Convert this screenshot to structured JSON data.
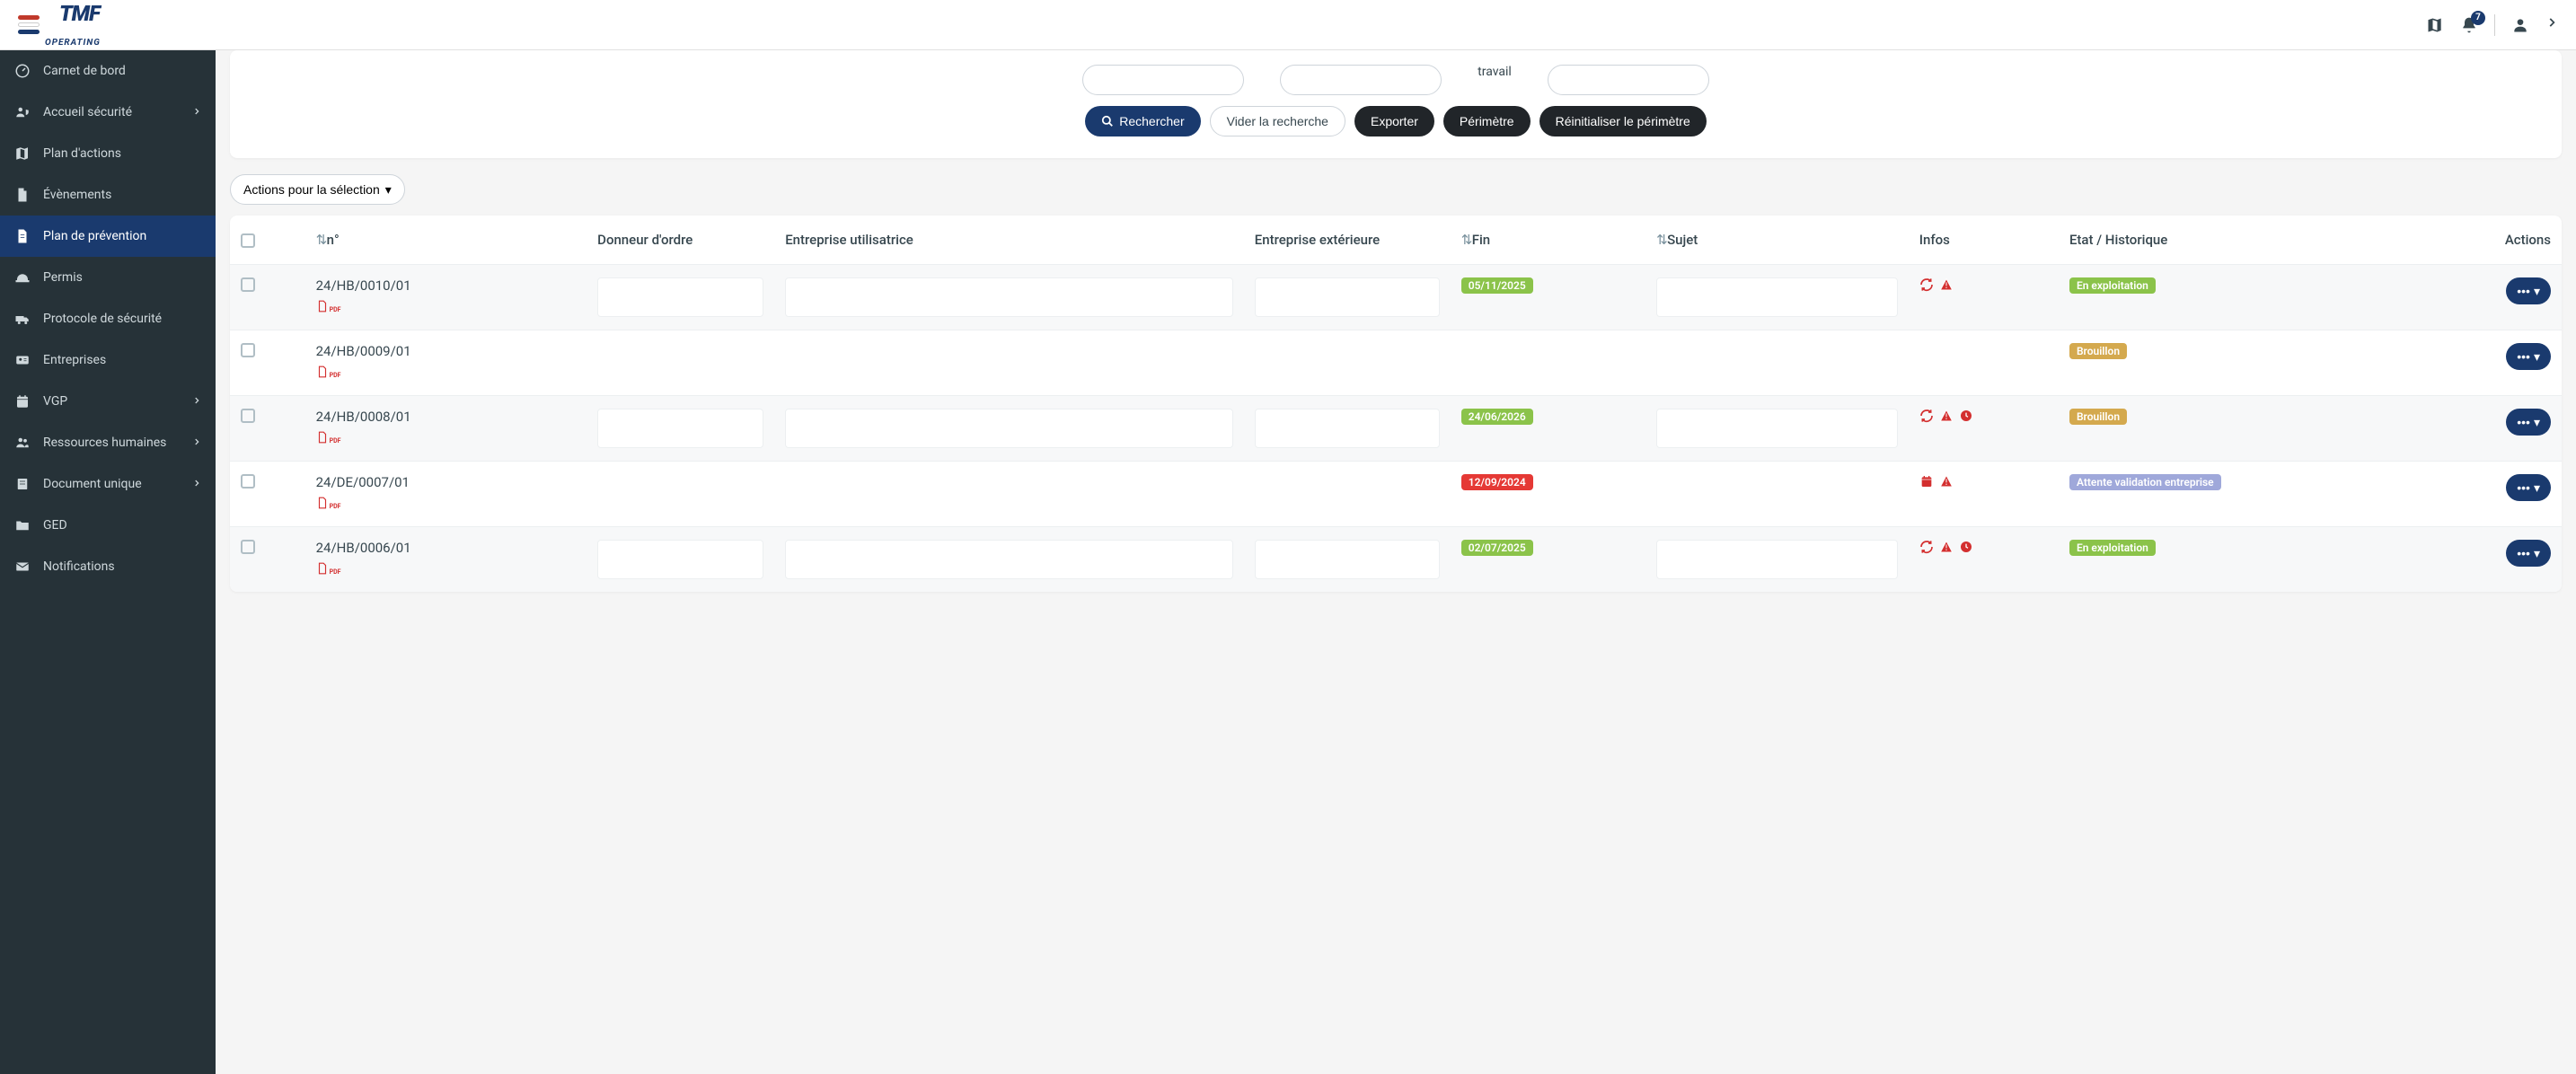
{
  "header": {
    "logo_main": "TMF",
    "logo_sub": "OPERATING",
    "notification_count": "7"
  },
  "sidebar": {
    "items": [
      {
        "label": "Carnet de bord",
        "icon": "dashboard",
        "expandable": false
      },
      {
        "label": "Accueil sécurité",
        "icon": "user-shield",
        "expandable": true
      },
      {
        "label": "Plan d'actions",
        "icon": "map",
        "expandable": false
      },
      {
        "label": "Évènements",
        "icon": "file",
        "expandable": false
      },
      {
        "label": "Plan de prévention",
        "icon": "file-alt",
        "expandable": false,
        "active": true
      },
      {
        "label": "Permis",
        "icon": "hard-hat",
        "expandable": false
      },
      {
        "label": "Protocole de sécurité",
        "icon": "truck",
        "expandable": false
      },
      {
        "label": "Entreprises",
        "icon": "id-card",
        "expandable": false
      },
      {
        "label": "VGP",
        "icon": "calendar",
        "expandable": true
      },
      {
        "label": "Ressources humaines",
        "icon": "users",
        "expandable": true
      },
      {
        "label": "Document unique",
        "icon": "book",
        "expandable": true
      },
      {
        "label": "GED",
        "icon": "folder",
        "expandable": false
      },
      {
        "label": "Notifications",
        "icon": "mail",
        "expandable": false
      }
    ]
  },
  "filters": {
    "travail_label": "travail",
    "buttons": {
      "search": "Rechercher",
      "clear": "Vider la recherche",
      "export": "Exporter",
      "perimeter": "Périmètre",
      "reset_perimeter": "Réinitialiser le périmètre"
    }
  },
  "bulk_actions_label": "Actions pour la sélection",
  "table": {
    "headers": {
      "num": "n°",
      "donneur": "Donneur d'ordre",
      "utilisatrice": "Entreprise utilisatrice",
      "exterieure": "Entreprise extérieure",
      "fin": "Fin",
      "sujet": "Sujet",
      "infos": "Infos",
      "etat": "Etat / Historique",
      "actions": "Actions"
    },
    "rows": [
      {
        "num": "24/HB/0010/01",
        "has_pdf": true,
        "donneur_box": true,
        "utilisatrice_box": true,
        "ext_box": true,
        "fin": "05/11/2025",
        "fin_color": "green",
        "sujet_box": true,
        "infos": [
          "refresh",
          "warning"
        ],
        "status": "En exploitation",
        "status_color": "green"
      },
      {
        "num": "24/HB/0009/01",
        "has_pdf": true,
        "donneur_box": false,
        "utilisatrice_box": false,
        "ext_box": false,
        "fin": "",
        "fin_color": "",
        "sujet_box": false,
        "infos": [],
        "status": "Brouillon",
        "status_color": "amber"
      },
      {
        "num": "24/HB/0008/01",
        "has_pdf": true,
        "donneur_box": true,
        "utilisatrice_box": true,
        "ext_box": true,
        "fin": "24/06/2026",
        "fin_color": "green",
        "sujet_box": true,
        "infos": [
          "refresh",
          "warning",
          "clock"
        ],
        "status": "Brouillon",
        "status_color": "amber"
      },
      {
        "num": "24/DE/0007/01",
        "has_pdf": true,
        "donneur_box": false,
        "utilisatrice_box": false,
        "ext_box": false,
        "fin": "12/09/2024",
        "fin_color": "red",
        "sujet_box": false,
        "infos": [
          "calendar",
          "warning"
        ],
        "status": "Attente validation entreprise",
        "status_color": "purple"
      },
      {
        "num": "24/HB/0006/01",
        "has_pdf": true,
        "donneur_box": true,
        "utilisatrice_box": true,
        "ext_box": true,
        "fin": "02/07/2025",
        "fin_color": "green",
        "sujet_box": true,
        "infos": [
          "refresh",
          "warning",
          "clock"
        ],
        "status": "En exploitation",
        "status_color": "green"
      }
    ]
  }
}
